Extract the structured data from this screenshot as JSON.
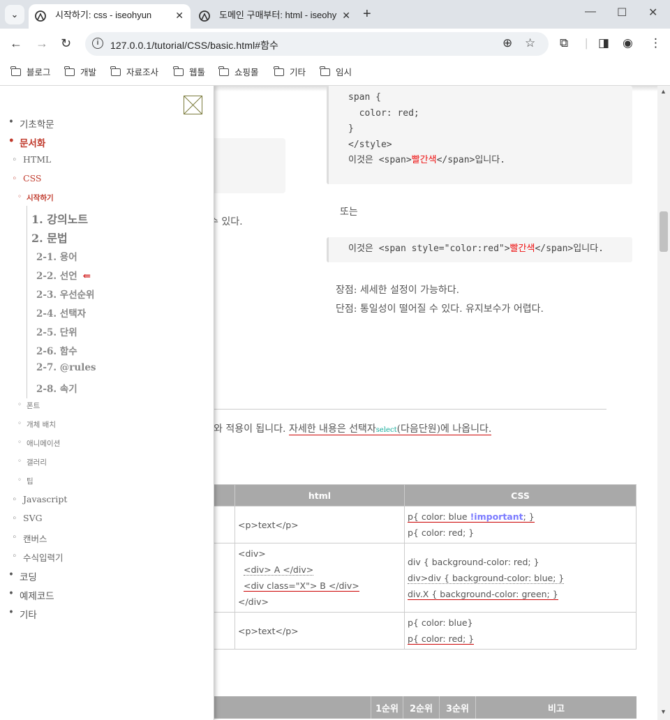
{
  "browser": {
    "tabs": [
      {
        "title": "시작하기: css - iseohyun",
        "active": true
      },
      {
        "title": "도메인 구매부터: html - iseohy",
        "active": false
      }
    ],
    "new_tab": "+",
    "url": "127.0.0.1/tutorial/CSS/basic.html#함수",
    "bookmarks": [
      "블로그",
      "개발",
      "자료조사",
      "웹툴",
      "쇼핑몰",
      "기타",
      "임시"
    ]
  },
  "content": {
    "code1": {
      "line1": "span {",
      "line2": "  color: red;",
      "line3": "}",
      "line4": "</style>",
      "line5_pre": "이것은 <span>",
      "line5_red": "빨간색",
      "line5_post": "</span>입니다."
    },
    "or_text": "또는",
    "code2": {
      "pre": "이것은 <span style=\"color:red\">",
      "red": "빨간색",
      "post": "</span>입니다."
    },
    "pros": "장점: 세세한 설정이 가능하다.",
    "cons": "단점: 통일성이 떨어질 수 있다. 유지보수가 어렵다.",
    "partial_text": "수 있다.",
    "para_pre": "와 적용이 됩니다. ",
    "para_link": "자세한 내용은 선택자",
    "para_select": "select",
    "para_post": "(다음단원)에 나옵니다.",
    "table1": {
      "headers": [
        "html",
        "CSS"
      ],
      "row1": {
        "html": "<p>text</p>",
        "css1_pre": "p{ color: blue ",
        "css1_imp": "!important",
        "css1_post": "; }",
        "css2": "p{ color: red; }"
      },
      "row2": {
        "html1": "<div>",
        "html2": "  <div> A </div>",
        "html3": "  <div class=\"X\"> B </div>",
        "html4": "</div>",
        "css1": "div { background-color: red; }",
        "css2": "div>div { background-color: blue; }",
        "css3": "div.X { background-color: green; }"
      },
      "row3": {
        "html": "<p>text</p>",
        "css1": "p{ color: blue}",
        "css2": "p{ color: red; }"
      }
    },
    "table2": {
      "headers": [
        "1순위",
        "2순위",
        "3순위",
        "비고"
      ]
    }
  },
  "sidebar": {
    "items": [
      {
        "label": "기초학문",
        "level": 1
      },
      {
        "label": "문서화",
        "level": 1,
        "active": true
      },
      {
        "label": "HTML",
        "level": 2
      },
      {
        "label": "CSS",
        "level": 2,
        "active": true
      },
      {
        "label": "시작하기",
        "level": 3,
        "active": true
      }
    ],
    "lectures": [
      "1. 강의노트",
      "2. 문법"
    ],
    "subs": [
      "2-1. 용어",
      "2-2. 선언",
      "2-3. 우선순위",
      "2-4. 선택자",
      "2-5. 단위",
      "2-6. 함수",
      "2-7. @rules",
      "2-8. 속기"
    ],
    "current_arrow": "⇐",
    "after": [
      {
        "label": "폰트",
        "level": 3
      },
      {
        "label": "개체 배치",
        "level": 3
      },
      {
        "label": "애니메이션",
        "level": 3
      },
      {
        "label": "갤러리",
        "level": 3
      },
      {
        "label": "팁",
        "level": 3
      },
      {
        "label": "Javascript",
        "level": 2
      },
      {
        "label": "SVG",
        "level": 2
      },
      {
        "label": "캔버스",
        "level": 2
      },
      {
        "label": "수식입력기",
        "level": 2
      },
      {
        "label": "코딩",
        "level": 1
      },
      {
        "label": "예제코드",
        "level": 1
      },
      {
        "label": "기타",
        "level": 1
      }
    ]
  }
}
